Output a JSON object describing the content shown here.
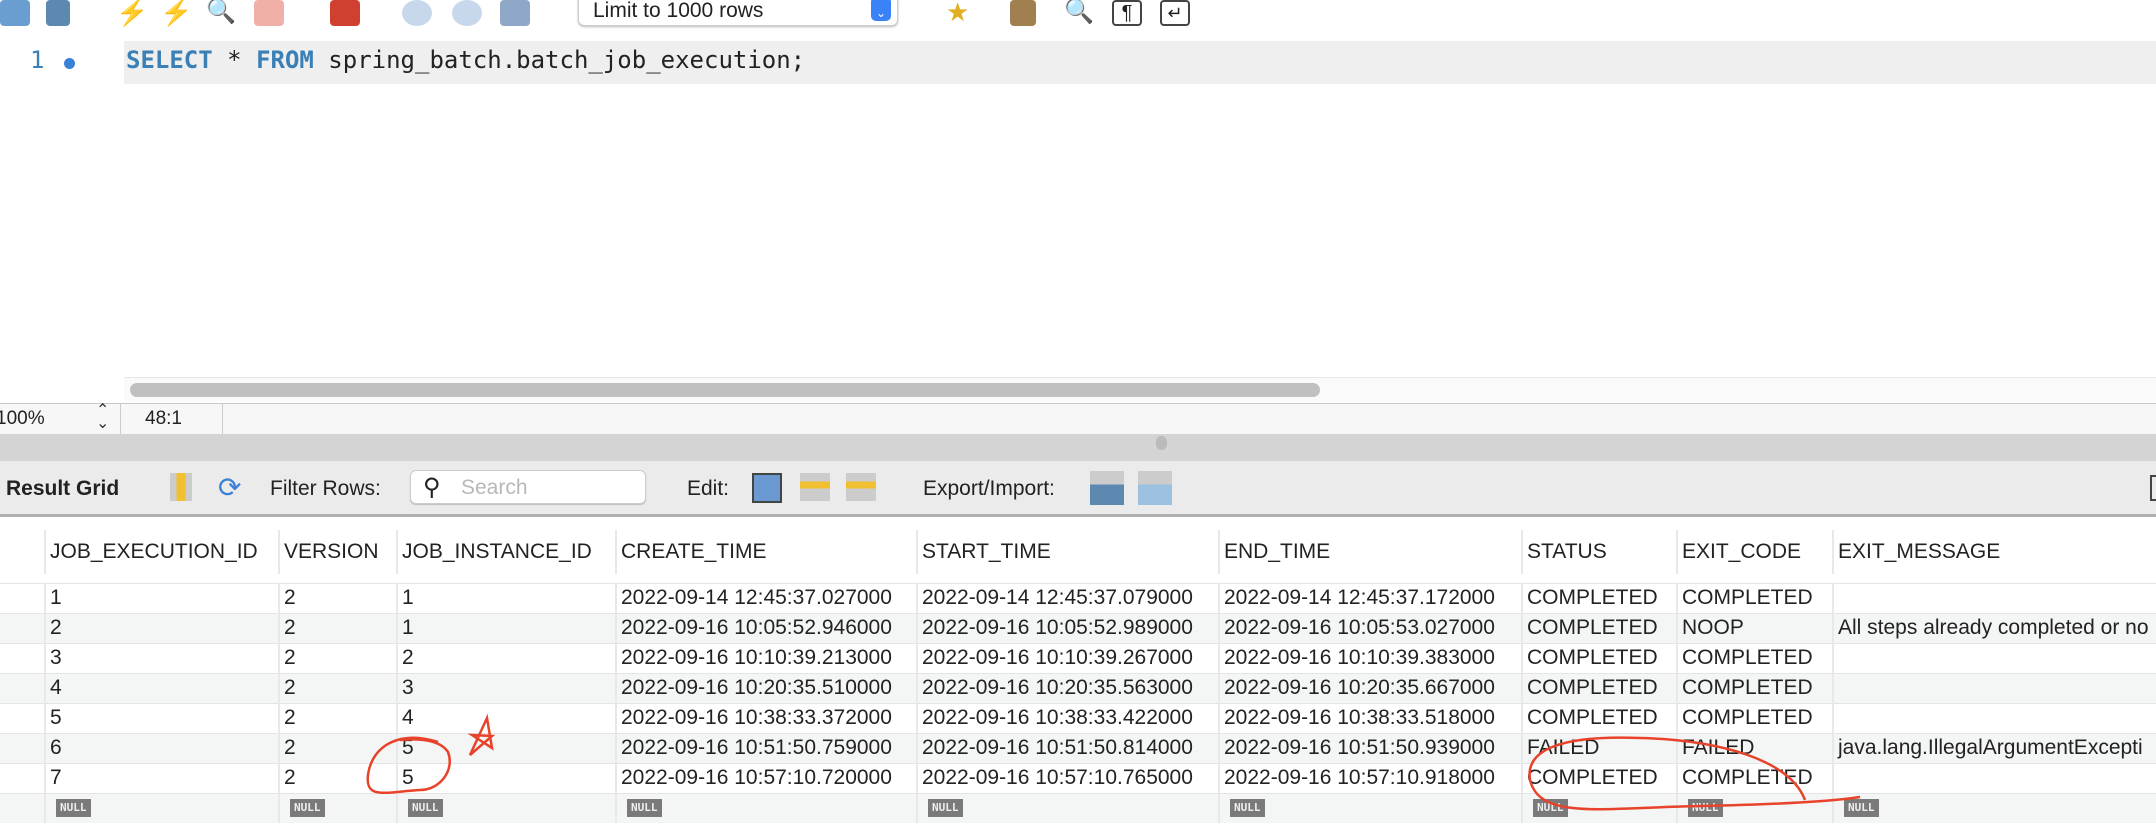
{
  "toolbar": {
    "limit_select": "Limit to 1000 rows",
    "icons": [
      "open-file-icon",
      "save-icon",
      "execute-icon",
      "execute-current-icon",
      "explain-icon",
      "stop-icon",
      "toggle-error-icon",
      "commit-icon",
      "rollback-icon",
      "autocommit-icon",
      "beautify-icon",
      "brush-icon",
      "find-icon",
      "invisible-chars-icon",
      "wrap-icon"
    ]
  },
  "editor": {
    "line_number": "1",
    "sql": {
      "kw1": "SELECT",
      "star": " * ",
      "kw2": "FROM",
      "rest": " spring_batch.batch_job_execution;"
    }
  },
  "statusbar": {
    "zoom": "100%",
    "cursor": "48:1"
  },
  "result_toolbar": {
    "title": "Result Grid",
    "filter_label": "Filter Rows:",
    "search_placeholder": "Search",
    "edit_label": "Edit:",
    "export_label": "Export/Import:"
  },
  "grid": {
    "columns": [
      "JOB_EXECUTION_ID",
      "VERSION",
      "JOB_INSTANCE_ID",
      "CREATE_TIME",
      "START_TIME",
      "END_TIME",
      "STATUS",
      "EXIT_CODE",
      "EXIT_MESSAGE"
    ],
    "rows": [
      [
        "1",
        "2",
        "1",
        "2022-09-14 12:45:37.027000",
        "2022-09-14 12:45:37.079000",
        "2022-09-14 12:45:37.172000",
        "COMPLETED",
        "COMPLETED",
        ""
      ],
      [
        "2",
        "2",
        "1",
        "2022-09-16 10:05:52.946000",
        "2022-09-16 10:05:52.989000",
        "2022-09-16 10:05:53.027000",
        "COMPLETED",
        "NOOP",
        "All steps already completed or no"
      ],
      [
        "3",
        "2",
        "2",
        "2022-09-16 10:10:39.213000",
        "2022-09-16 10:10:39.267000",
        "2022-09-16 10:10:39.383000",
        "COMPLETED",
        "COMPLETED",
        ""
      ],
      [
        "4",
        "2",
        "3",
        "2022-09-16 10:20:35.510000",
        "2022-09-16 10:20:35.563000",
        "2022-09-16 10:20:35.667000",
        "COMPLETED",
        "COMPLETED",
        ""
      ],
      [
        "5",
        "2",
        "4",
        "2022-09-16 10:38:33.372000",
        "2022-09-16 10:38:33.422000",
        "2022-09-16 10:38:33.518000",
        "COMPLETED",
        "COMPLETED",
        ""
      ],
      [
        "6",
        "2",
        "5",
        "2022-09-16 10:51:50.759000",
        "2022-09-16 10:51:50.814000",
        "2022-09-16 10:51:50.939000",
        "FAILED",
        "FAILED",
        "java.lang.IllegalArgumentExcepti"
      ],
      [
        "7",
        "2",
        "5",
        "2022-09-16 10:57:10.720000",
        "2022-09-16 10:57:10.765000",
        "2022-09-16 10:57:10.918000",
        "COMPLETED",
        "COMPLETED",
        ""
      ]
    ],
    "null_label": "NULL"
  },
  "colors": {
    "keyword": "#3a7fb5",
    "annotation": "#e8432a",
    "null_badge": "#7a7a7a"
  }
}
